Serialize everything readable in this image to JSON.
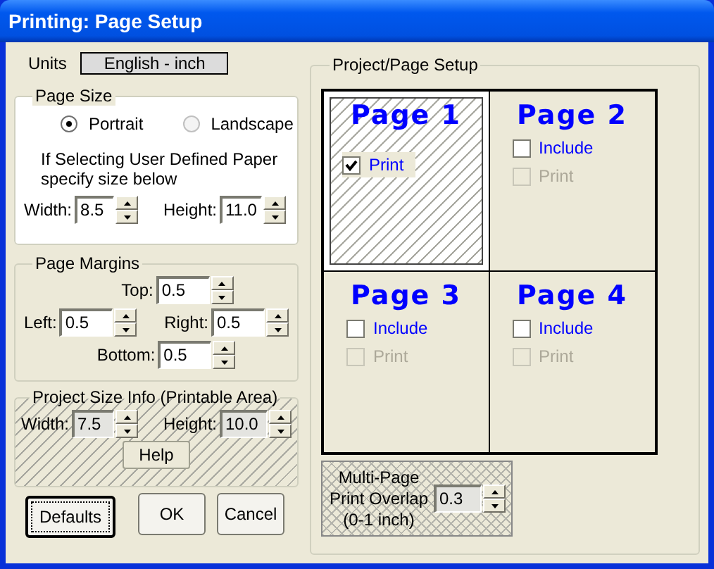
{
  "window": {
    "title": "Printing: Page Setup"
  },
  "units": {
    "label": "Units",
    "value": "English - inch"
  },
  "page_size": {
    "title": "Page Size",
    "orientations": [
      {
        "label": "Portrait",
        "selected": true
      },
      {
        "label": "Landscape",
        "selected": false
      }
    ],
    "note": "If Selecting User Defined Paper specify size below",
    "fields": [
      {
        "label": "Width:",
        "value": "8.5",
        "disabled": false
      },
      {
        "label": "Height:",
        "value": "11.0",
        "disabled": false
      }
    ]
  },
  "page_margins": {
    "title": "Page Margins",
    "fields": [
      {
        "label": "Top:",
        "value": "0.5",
        "disabled": false
      },
      {
        "label": "Left:",
        "value": "0.5",
        "disabled": false
      },
      {
        "label": "Right:",
        "value": "0.5",
        "disabled": false
      },
      {
        "label": "Bottom:",
        "value": "0.5",
        "disabled": false
      }
    ]
  },
  "project_size": {
    "title": "Project Size Info (Printable Area)",
    "fields": [
      {
        "label": "Width:",
        "value": "7.5",
        "disabled": true
      },
      {
        "label": "Height:",
        "value": "10.0",
        "disabled": true
      }
    ],
    "help": "Help"
  },
  "buttons": [
    {
      "label": "Defaults",
      "focused": true
    },
    {
      "label": "OK",
      "focused": false
    },
    {
      "label": "Cancel",
      "focused": false
    }
  ],
  "project_setup": {
    "title": "Project/Page Setup",
    "pages": [
      {
        "title": "Page 1",
        "selected": true,
        "checkboxes": [
          {
            "label": "Print",
            "checked": true,
            "disabled": false
          }
        ]
      },
      {
        "title": "Page 2",
        "selected": false,
        "checkboxes": [
          {
            "label": "Include",
            "checked": false,
            "disabled": false
          },
          {
            "label": "Print",
            "checked": false,
            "disabled": true
          }
        ]
      },
      {
        "title": "Page 3",
        "selected": false,
        "checkboxes": [
          {
            "label": "Include",
            "checked": false,
            "disabled": false
          },
          {
            "label": "Print",
            "checked": false,
            "disabled": true
          }
        ]
      },
      {
        "title": "Page 4",
        "selected": false,
        "checkboxes": [
          {
            "label": "Include",
            "checked": false,
            "disabled": false
          },
          {
            "label": "Print",
            "checked": false,
            "disabled": true
          }
        ]
      }
    ],
    "overlap": {
      "lines": [
        "Multi-Page",
        "Print Overlap",
        "(0-1 inch)"
      ],
      "value": "0.3",
      "disabled": true
    }
  }
}
